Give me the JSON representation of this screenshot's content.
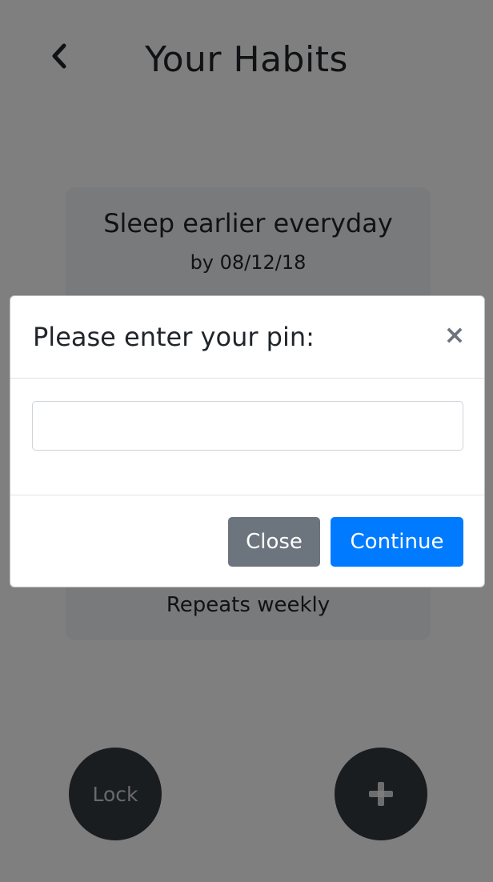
{
  "header": {
    "title": "Your Habits",
    "back_icon": "chevron-left-icon"
  },
  "habit": {
    "name": "Sleep earlier everyday",
    "date": "by 08/12/18",
    "repeat": "Repeats weekly"
  },
  "fab": {
    "lock_label": "Lock",
    "add_icon": "plus-icon"
  },
  "modal": {
    "title": "Please enter your pin:",
    "close_x": "×",
    "pin_value": "",
    "close_label": "Close",
    "continue_label": "Continue"
  },
  "colors": {
    "primary": "#007bff",
    "secondary": "#6c757d",
    "dark": "#343a40",
    "card": "#f3f4f6",
    "backdrop": "rgba(0,0,0,0.5)"
  }
}
